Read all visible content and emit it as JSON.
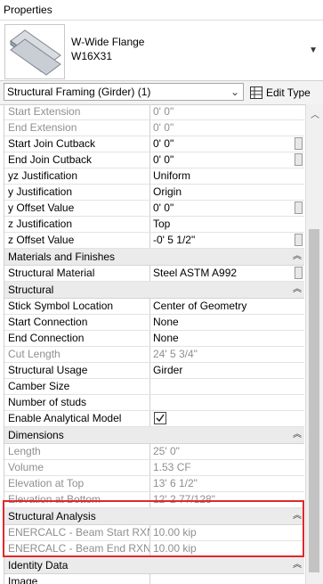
{
  "panel": {
    "title": "Properties"
  },
  "type_selector": {
    "family": "W-Wide Flange",
    "type": "W16X31",
    "thumb_icon": "steel-beam-icon",
    "dropdown_icon": "triangle-down-icon"
  },
  "filter": {
    "selected": "Structural Framing (Girder) (1)",
    "edit_type_label": "Edit Type"
  },
  "rows_a": [
    {
      "label": "Start Extension",
      "value": "0'  0\"",
      "gray": true
    },
    {
      "label": "End Extension",
      "value": "0'  0\"",
      "gray": true
    },
    {
      "label": "Start Join Cutback",
      "value": "0'  0\"",
      "btn": true
    },
    {
      "label": "End Join Cutback",
      "value": "0'  0\"",
      "btn": true
    },
    {
      "label": "yz Justification",
      "value": "Uniform"
    },
    {
      "label": "y Justification",
      "value": "Origin"
    },
    {
      "label": "y Offset Value",
      "value": "0'  0\"",
      "btn": true
    },
    {
      "label": "z Justification",
      "value": "Top"
    },
    {
      "label": "z Offset Value",
      "value": "-0'  5 1/2\"",
      "btn": true
    }
  ],
  "groups": {
    "materials": "Materials and Finishes",
    "structural": "Structural",
    "dimensions": "Dimensions",
    "analysis": "Structural Analysis",
    "identity": "Identity Data"
  },
  "rows_materials": [
    {
      "label": "Structural Material",
      "value": "Steel ASTM A992",
      "btn": true
    }
  ],
  "rows_structural": [
    {
      "label": "Stick Symbol Location",
      "value": "Center of Geometry"
    },
    {
      "label": "Start Connection",
      "value": "None"
    },
    {
      "label": "End Connection",
      "value": "None"
    },
    {
      "label": "Cut Length",
      "value": "24'  5 3/4\"",
      "gray": true
    },
    {
      "label": "Structural Usage",
      "value": "Girder"
    },
    {
      "label": "Camber Size",
      "value": ""
    },
    {
      "label": "Number of studs",
      "value": ""
    },
    {
      "label": "Enable Analytical Model",
      "value": "",
      "checkbox": true,
      "checked": true
    }
  ],
  "rows_dimensions": [
    {
      "label": "Length",
      "value": "25'  0\"",
      "gray": true
    },
    {
      "label": "Volume",
      "value": "1.53 CF",
      "gray": true
    },
    {
      "label": "Elevation at Top",
      "value": "13'  6 1/2\"",
      "gray": true
    },
    {
      "label": "Elevation at Bottom",
      "value": "12'  2 77/128\"",
      "gray": true
    }
  ],
  "rows_analysis": [
    {
      "label": "ENERCALC - Beam Start RXN",
      "value": "10.00 kip",
      "gray": true
    },
    {
      "label": "ENERCALC - Beam End RXN",
      "value": "10.00 kip",
      "gray": true
    }
  ],
  "rows_identity": [
    {
      "label": "Image",
      "value": ""
    }
  ],
  "highlight_color": "#e0282e"
}
